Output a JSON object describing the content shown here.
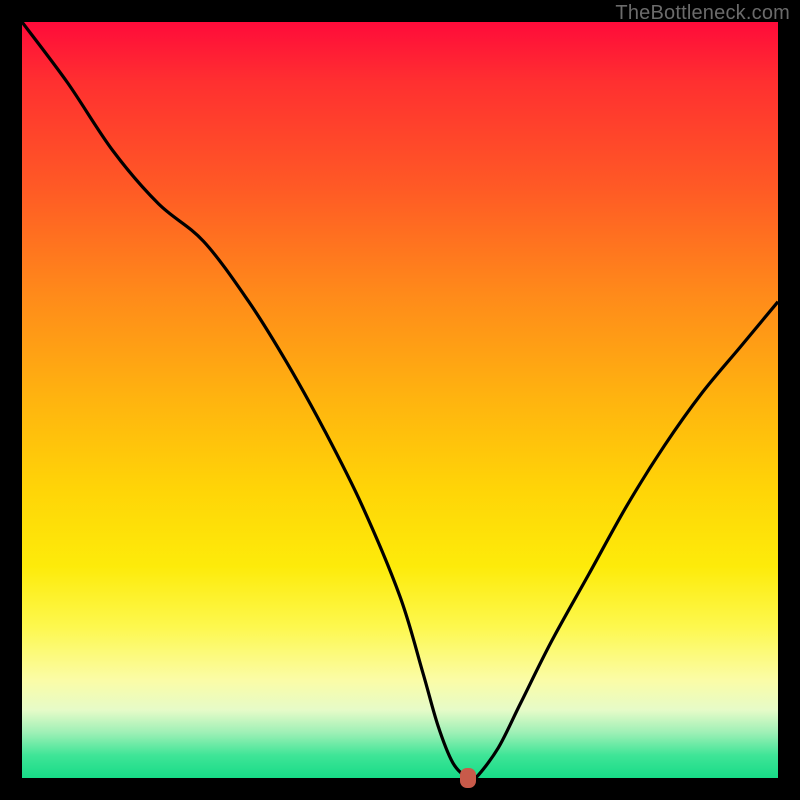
{
  "attribution": "TheBottleneck.com",
  "colors": {
    "curve": "#000000",
    "marker": "#c85a4a",
    "frame": "#000000"
  },
  "chart_data": {
    "type": "line",
    "title": "",
    "xlabel": "",
    "ylabel": "",
    "xlim": [
      0,
      100
    ],
    "ylim": [
      0,
      100
    ],
    "series": [
      {
        "name": "bottleneck-curve",
        "x": [
          0,
          6,
          12,
          18,
          24,
          30,
          35,
          40,
          45,
          50,
          53,
          55,
          57,
          59,
          60,
          63,
          66,
          70,
          75,
          80,
          85,
          90,
          95,
          100
        ],
        "y": [
          100,
          92,
          83,
          76,
          71,
          63,
          55,
          46,
          36,
          24,
          14,
          7,
          2,
          0,
          0,
          4,
          10,
          18,
          27,
          36,
          44,
          51,
          57,
          63
        ]
      }
    ],
    "annotations": [
      {
        "name": "optimal-marker",
        "x": 59,
        "y": 0
      }
    ]
  }
}
